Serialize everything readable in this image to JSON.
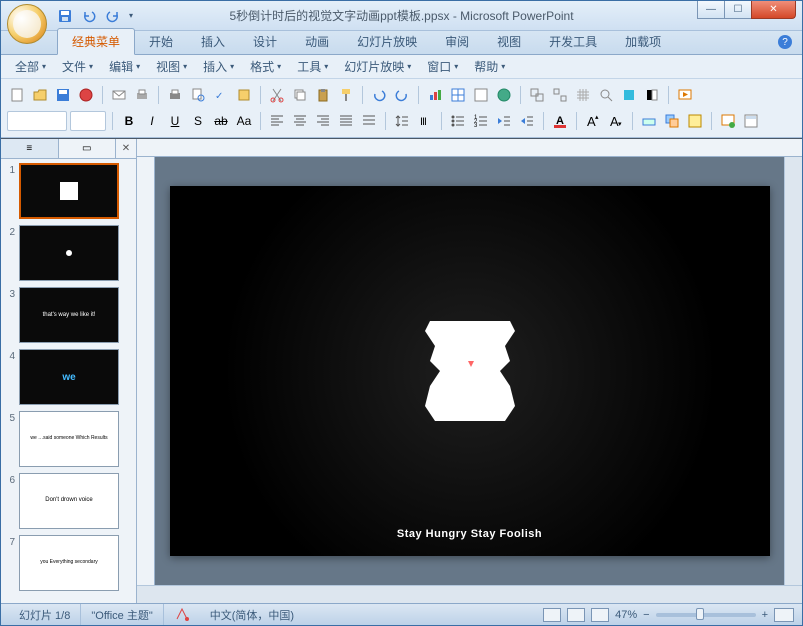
{
  "window": {
    "title": "5秒倒计时后的视觉文字动画ppt模板.ppsx - Microsoft PowerPoint"
  },
  "ribbon": {
    "tabs": [
      "经典菜单",
      "开始",
      "插入",
      "设计",
      "动画",
      "幻灯片放映",
      "审阅",
      "视图",
      "开发工具",
      "加载项"
    ],
    "active": 0
  },
  "menubar": {
    "items": [
      "全部",
      "文件",
      "编辑",
      "视图",
      "插入",
      "格式",
      "工具",
      "幻灯片放映",
      "窗口",
      "帮助"
    ]
  },
  "thumbnails": {
    "tabs": {
      "outline_icon": "≡",
      "slides_icon": "▭"
    },
    "slides": [
      {
        "n": "1",
        "bg": "dark",
        "preview": "shape"
      },
      {
        "n": "2",
        "bg": "dark",
        "preview": "dot"
      },
      {
        "n": "3",
        "bg": "dark",
        "preview_text": "that's way we like it!"
      },
      {
        "n": "4",
        "bg": "dark",
        "preview_text": "we"
      },
      {
        "n": "5",
        "bg": "white",
        "preview_text": "we …said someone Which Results"
      },
      {
        "n": "6",
        "bg": "white",
        "preview_text": "Don't drown voice"
      },
      {
        "n": "7",
        "bg": "white",
        "preview_text": "you Everything secondary"
      }
    ],
    "selected": 0
  },
  "slide": {
    "caption": "Stay Hungry   Stay Foolish"
  },
  "statusbar": {
    "slide_info": "幻灯片 1/8",
    "theme": "\"Office 主题\"",
    "language": "中文(简体，中国)",
    "zoom": "47%"
  },
  "icons": {
    "save": "💾",
    "undo": "↶",
    "redo": "↷",
    "min": "—",
    "max": "☐",
    "close": "✕",
    "help": "?",
    "plus": "+",
    "minus": "−"
  }
}
